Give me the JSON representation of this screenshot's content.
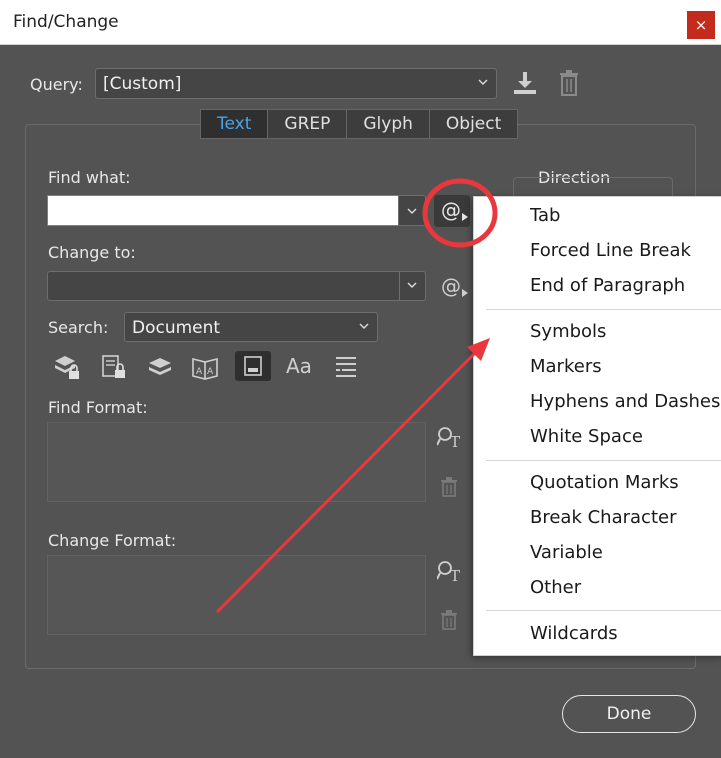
{
  "window": {
    "title": "Find/Change",
    "close_icon": "×"
  },
  "query": {
    "label": "Query:",
    "value": "[Custom]"
  },
  "tabs": [
    {
      "label": "Text",
      "active": true
    },
    {
      "label": "GREP",
      "active": false
    },
    {
      "label": "Glyph",
      "active": false
    },
    {
      "label": "Object",
      "active": false
    }
  ],
  "find": {
    "label": "Find what:",
    "value": ""
  },
  "change": {
    "label": "Change to:",
    "value": ""
  },
  "direction": {
    "label": "Direction"
  },
  "search": {
    "label": "Search:",
    "value": "Document"
  },
  "find_format": {
    "label": "Find Format:"
  },
  "change_format": {
    "label": "Change Format:"
  },
  "special_char_menu": {
    "items": [
      "Tab",
      "Forced Line Break",
      "End of Paragraph",
      "Symbols",
      "Markers",
      "Hyphens and Dashes",
      "White Space",
      "Quotation Marks",
      "Break Character",
      "Variable",
      "Other",
      "Wildcards"
    ]
  },
  "option_icons": [
    "include-locked-layers-icon",
    "include-locked-stories-icon",
    "include-hidden-layers-icon",
    "include-master-pages-icon",
    "include-footnotes-icon",
    "case-sensitive-icon",
    "whole-word-icon"
  ],
  "case_label": "Aa",
  "done_label": "Done",
  "colors": {
    "accent": "#4aa3e8",
    "annotation_red": "#e8383d",
    "background": "#535353"
  }
}
